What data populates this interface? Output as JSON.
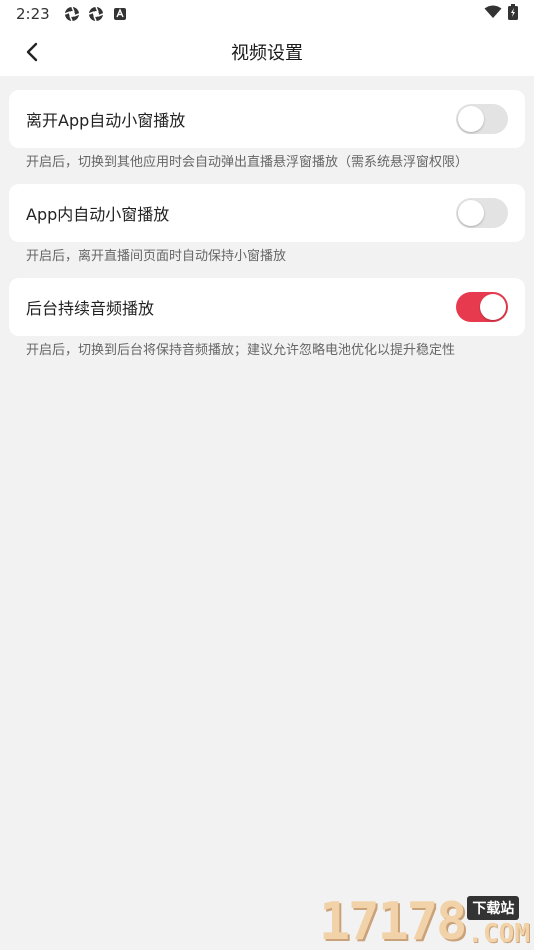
{
  "status_bar": {
    "time": "2:23",
    "left_icons": [
      "aperture-icon",
      "aperture-icon",
      "app-badge-icon"
    ],
    "right_icons": [
      "wifi-icon",
      "battery-charging-icon"
    ]
  },
  "header": {
    "title": "视频设置",
    "back_icon": "chevron-left-icon"
  },
  "settings": [
    {
      "label": "离开App自动小窗播放",
      "enabled": false,
      "hint": "开启后，切换到其他应用时会自动弹出直播悬浮窗播放（需系统悬浮窗权限）"
    },
    {
      "label": "App内自动小窗播放",
      "enabled": false,
      "hint": "开启后，离开直播间页面时自动保持小窗播放"
    },
    {
      "label": "后台持续音频播放",
      "enabled": true,
      "hint": "开启后，切换到后台将保持音频播放；建议允许忽略电池优化以提升稳定性"
    }
  ],
  "colors": {
    "toggle_on": "#e83a4f",
    "toggle_off": "#e3e3e3",
    "background": "#f2f2f2"
  },
  "watermark": {
    "number": "17178",
    "tag": "下载站",
    "suffix": ".COM"
  }
}
